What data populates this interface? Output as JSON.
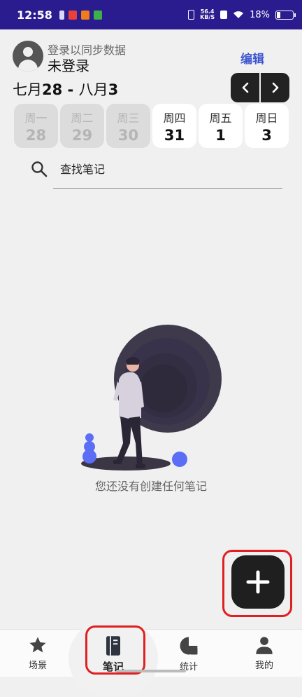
{
  "status_bar": {
    "time": "12:58",
    "net_speed_value": "56.4",
    "net_speed_unit": "KB/S",
    "battery": "18%"
  },
  "header": {
    "login_hint": "登录以同步数据",
    "login_status": "未登录",
    "edit_label": "编辑"
  },
  "date_range": {
    "start_month": "七月",
    "start_day": "28",
    "separator": " - ",
    "end_month": "八月",
    "end_day": "3"
  },
  "week": [
    {
      "weekday": "周一",
      "date": "28",
      "past": true
    },
    {
      "weekday": "周二",
      "date": "29",
      "past": true
    },
    {
      "weekday": "周三",
      "date": "30",
      "past": true
    },
    {
      "weekday": "周四",
      "date": "31",
      "past": false
    },
    {
      "weekday": "周五",
      "date": "1",
      "past": false
    },
    {
      "weekday": "周日",
      "date": "3",
      "past": false
    }
  ],
  "search": {
    "placeholder": "查找笔记"
  },
  "empty_state": {
    "message": "您还没有创建任何笔记"
  },
  "bottom_nav": [
    {
      "label": "场景",
      "icon": "star-icon"
    },
    {
      "label": "笔记",
      "icon": "notebook-icon",
      "active": true
    },
    {
      "label": "统计",
      "icon": "stats-icon"
    },
    {
      "label": "我的",
      "icon": "person-icon"
    }
  ],
  "colors": {
    "accent": "#3e55d1",
    "status_bar": "#2a1b8f",
    "fab": "#1f1f1f",
    "highlight": "#e02020",
    "illustration_blue": "#5b6ef5"
  }
}
